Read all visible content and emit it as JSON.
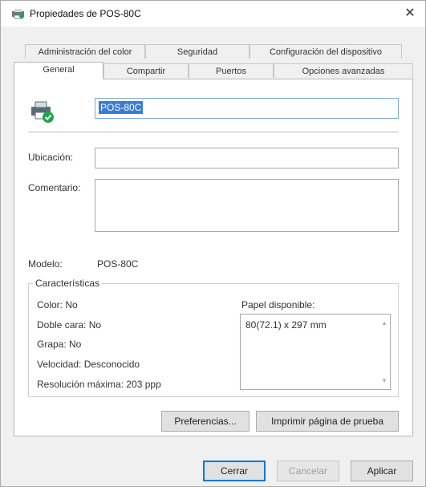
{
  "window": {
    "title": "Propiedades de POS-80C",
    "close_glyph": "✕"
  },
  "tabs": {
    "row1": [
      "Administración del color",
      "Seguridad",
      "Configuración del dispositivo"
    ],
    "row2": [
      "General",
      "Compartir",
      "Puertos",
      "Opciones avanzadas"
    ],
    "active": "General"
  },
  "general": {
    "printer_icon": "printer-icon",
    "name_value": "POS-80C",
    "location_label": "Ubicación:",
    "location_value": "",
    "comment_label": "Comentario:",
    "comment_value": "",
    "model_label": "Modelo:",
    "model_value": "POS-80C"
  },
  "features": {
    "title": "Características",
    "color": "Color: No",
    "duplex": "Doble cara: No",
    "staple": "Grapa: No",
    "speed": "Velocidad: Desconocido",
    "max_resolution": "Resolución máxima: 203 ppp",
    "paper_label": "Papel disponible:",
    "paper_items": [
      "80(72.1) x 297 mm"
    ]
  },
  "buttons": {
    "preferences": "Preferencias...",
    "print_test": "Imprimir página de prueba",
    "close": "Cerrar",
    "cancel": "Cancelar",
    "apply": "Aplicar"
  },
  "colors": {
    "selection": "#3a7bd5",
    "default_button_border": "#0078d7",
    "check_badge": "#1aa84a"
  }
}
